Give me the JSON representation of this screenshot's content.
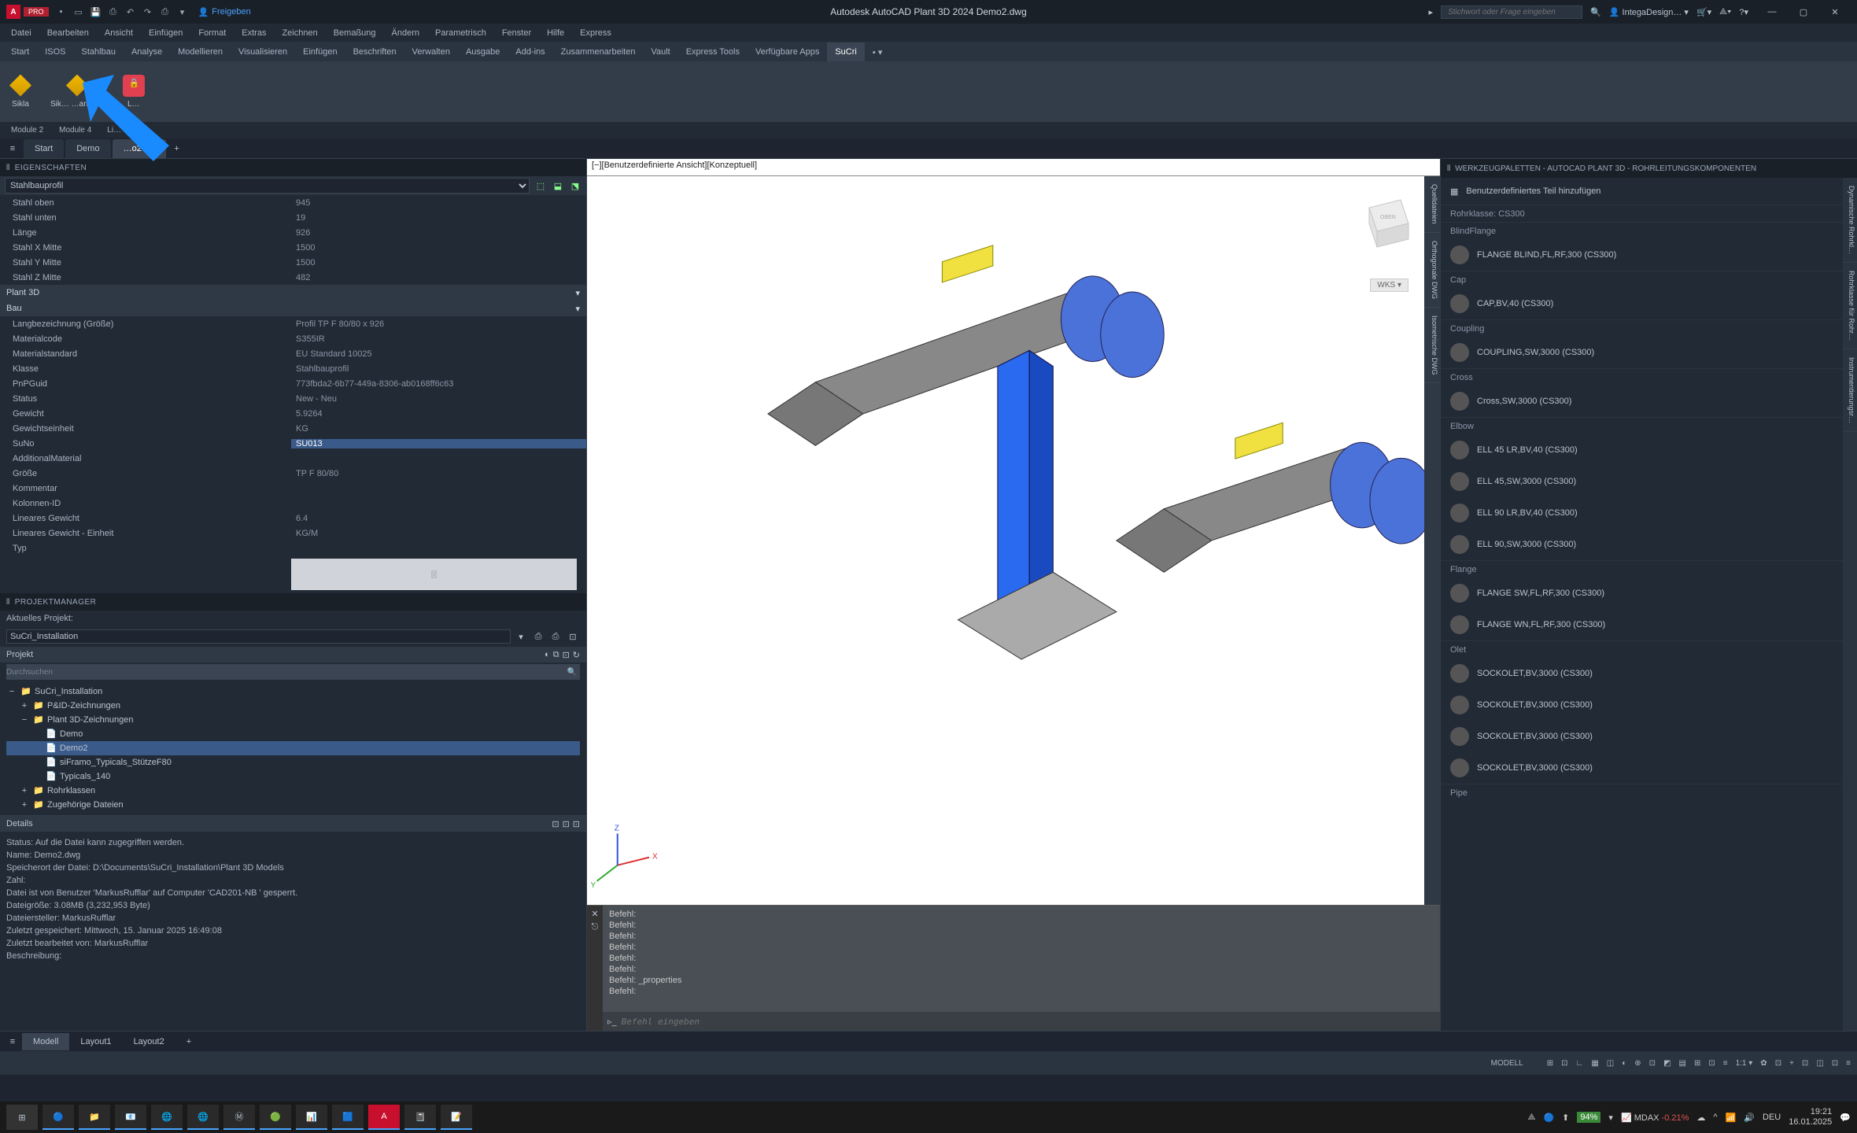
{
  "titlebar": {
    "app_badge": "PRO",
    "share": "Freigeben",
    "title": "Autodesk AutoCAD Plant 3D 2024   Demo2.dwg",
    "search_placeholder": "Stichwort oder Frage eingeben",
    "user": "IntegaDesign…",
    "win_min": "—",
    "win_max": "▢",
    "win_close": "✕"
  },
  "menubar": [
    "Datei",
    "Bearbeiten",
    "Ansicht",
    "Einfügen",
    "Format",
    "Extras",
    "Zeichnen",
    "Bemaßung",
    "Ändern",
    "Parametrisch",
    "Fenster",
    "Hilfe",
    "Express"
  ],
  "ribbon_tabs": [
    "Start",
    "ISOS",
    "Stahlbau",
    "Analyse",
    "Modellieren",
    "Visualisieren",
    "Einfügen",
    "Beschriften",
    "Verwalten",
    "Ausgabe",
    "Add-ins",
    "Zusammenarbeiten",
    "Vault",
    "Express Tools",
    "Verfügbare Apps",
    "SuCri"
  ],
  "ribbon_active": "SuCri",
  "ribbon_groups": [
    {
      "label": "Sikla",
      "color": "#f0b800"
    },
    {
      "label": "Sik…  …anager",
      "color": "#f0b800"
    },
    {
      "label": "L…",
      "color": "#e04050"
    }
  ],
  "module_tabs": [
    "Module 2",
    "Module 4",
    "Li…"
  ],
  "doc_tabs": {
    "start": "Start",
    "tabs": [
      {
        "label": "Demo",
        "active": false
      },
      {
        "label": "…o2*",
        "active": true,
        "close": "×"
      }
    ],
    "plus": "+"
  },
  "properties": {
    "header": "EIGENSCHAFTEN",
    "filter": "Stahlbauprofil",
    "rows1": [
      {
        "k": "Stahl oben",
        "v": "945"
      },
      {
        "k": "Stahl unten",
        "v": "19"
      },
      {
        "k": "Länge",
        "v": "926"
      },
      {
        "k": "Stahl X Mitte",
        "v": "1500"
      },
      {
        "k": "Stahl Y Mitte",
        "v": "1500"
      },
      {
        "k": "Stahl Z Mitte",
        "v": "482"
      }
    ],
    "section1": "Plant 3D",
    "section2": "Bau",
    "rows2": [
      {
        "k": "Langbezeichnung (Größe)",
        "v": "Profil TP F 80/80 x 926"
      },
      {
        "k": "Materialcode",
        "v": "S355IR"
      },
      {
        "k": "Materialstandard",
        "v": "EU Standard 10025"
      },
      {
        "k": "Klasse",
        "v": "Stahlbauprofil"
      },
      {
        "k": "PnPGuid",
        "v": "773fbda2-6b77-449a-8306-ab0168ff6c63"
      },
      {
        "k": "Status",
        "v": "New - Neu"
      },
      {
        "k": "Gewicht",
        "v": "5.9264"
      },
      {
        "k": "Gewichtseinheit",
        "v": "KG"
      },
      {
        "k": "SuNo",
        "v": "SU013",
        "hl": true
      },
      {
        "k": "AdditionalMaterial",
        "v": ""
      },
      {
        "k": "Größe",
        "v": "TP F 80/80"
      },
      {
        "k": "Kommentar",
        "v": ""
      },
      {
        "k": "Kolonnen-ID",
        "v": ""
      },
      {
        "k": "Lineares Gewicht",
        "v": "6.4"
      },
      {
        "k": "Lineares Gewicht - Einheit",
        "v": "KG/M"
      },
      {
        "k": "Typ",
        "v": ""
      }
    ]
  },
  "pm": {
    "header": "PROJEKTMANAGER",
    "label": "Aktuelles Projekt:",
    "project": "SuCri_Installation",
    "bar": "Projekt",
    "search": "Durchsuchen",
    "tree": [
      {
        "lvl": 0,
        "exp": "−",
        "ico": "📁",
        "t": "SuCri_Installation"
      },
      {
        "lvl": 1,
        "exp": "+",
        "ico": "📁",
        "t": "P&ID-Zeichnungen"
      },
      {
        "lvl": 1,
        "exp": "−",
        "ico": "📁",
        "t": "Plant 3D-Zeichnungen"
      },
      {
        "lvl": 2,
        "exp": "",
        "ico": "📄",
        "t": "Demo"
      },
      {
        "lvl": 2,
        "exp": "",
        "ico": "📄",
        "t": "Demo2",
        "sel": true
      },
      {
        "lvl": 2,
        "exp": "",
        "ico": "📄",
        "t": "siFramo_Typicals_StützeF80"
      },
      {
        "lvl": 2,
        "exp": "",
        "ico": "📄",
        "t": "Typicals_140"
      },
      {
        "lvl": 1,
        "exp": "+",
        "ico": "📁",
        "t": "Rohrklassen"
      },
      {
        "lvl": 1,
        "exp": "+",
        "ico": "📁",
        "t": "Zugehörige Dateien"
      }
    ],
    "details_hdr": "Details",
    "details": [
      "Status: Auf die Datei kann zugegriffen werden.",
      "Name: Demo2.dwg",
      "Speicherort der Datei: D:\\Documents\\SuCri_Installation\\Plant 3D Models",
      "Zahl:",
      "Datei ist von Benutzer 'MarkusRufflar' auf Computer 'CAD201-NB ' gesperrt.",
      "Dateigröße: 3.08MB (3,232,953 Byte)",
      "Dateiersteller: MarkusRufflar",
      "Zuletzt gespeichert: Mittwoch, 15. Januar 2025 16:49:08",
      "Zuletzt bearbeitet von: MarkusRufflar",
      "Beschreibung:"
    ]
  },
  "viewport": {
    "label": "[−][Benutzerdefinierte Ansicht][Konzeptuell]",
    "wcs": "WKS ▾"
  },
  "cmd": {
    "lines": [
      "Befehl:",
      "Befehl:",
      "Befehl:",
      "Befehl:",
      "Befehl:",
      "Befehl:",
      "Befehl: _properties",
      "Befehl:"
    ],
    "placeholder": "Befehl eingeben"
  },
  "vp_side_tabs": [
    "Quelldateien",
    "Orthogonale DWG",
    "Isometrische DWG"
  ],
  "tool_palette": {
    "header": "WERKZEUGPALETTEN - AUTOCAD PLANT 3D - ROHRLEITUNGSKOMPONENTEN",
    "add": "Benutzerdefiniertes Teil hinzufügen",
    "sections": [
      {
        "title": "Rohrklasse: CS300",
        "items": []
      },
      {
        "title": "BlindFlange",
        "items": [
          "FLANGE BLIND,FL,RF,300 (CS300)"
        ]
      },
      {
        "title": "Cap",
        "items": [
          "CAP,BV,40 (CS300)"
        ]
      },
      {
        "title": "Coupling",
        "items": [
          "COUPLING,SW,3000 (CS300)"
        ]
      },
      {
        "title": "Cross",
        "items": [
          "Cross,SW,3000 (CS300)"
        ]
      },
      {
        "title": "Elbow",
        "items": [
          "ELL 45 LR,BV,40 (CS300)",
          "ELL 45,SW,3000 (CS300)",
          "ELL 90 LR,BV,40 (CS300)",
          "ELL 90,SW,3000 (CS300)"
        ]
      },
      {
        "title": "Flange",
        "items": [
          "FLANGE SW,FL,RF,300 (CS300)",
          "FLANGE WN,FL,RF,300 (CS300)"
        ]
      },
      {
        "title": "Olet",
        "items": [
          "SOCKOLET,BV,3000 (CS300)",
          "SOCKOLET,BV,3000 (CS300)",
          "SOCKOLET,BV,3000 (CS300)",
          "SOCKOLET,BV,3000 (CS300)"
        ]
      },
      {
        "title": "Pipe",
        "items": []
      }
    ],
    "side_tabs": [
      "Dynamische Rohrkl…",
      "Rohrklasse für Rohr…",
      "Instrumentierungsr…"
    ]
  },
  "model_tabs": {
    "burger": "≡",
    "tabs": [
      "Modell",
      "Layout1",
      "Layout2"
    ],
    "plus": "+"
  },
  "statusbar": {
    "model": "MODELL",
    "items": [
      "⊞",
      "⊡",
      "∟",
      "▦",
      "◫",
      "◐",
      "⊕",
      "⊡",
      "◩",
      "▤",
      "⊞",
      "⊡",
      "≡",
      "1:1 ▾",
      "✿",
      "⊡",
      "+",
      "⊡",
      "◫",
      "⊡",
      "≡"
    ]
  },
  "taskbar": {
    "tray": {
      "battery": "94%",
      "stock_name": "MDAX",
      "stock_val": "-0.21%",
      "time": "19:21",
      "date": "16.01.2025"
    }
  }
}
